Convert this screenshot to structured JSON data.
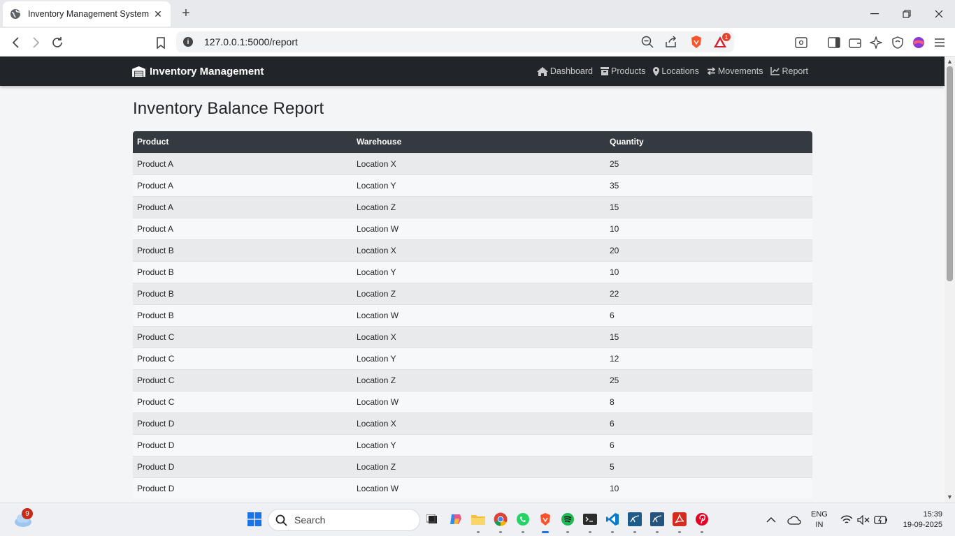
{
  "browser": {
    "tab_title": "Inventory Management System",
    "url": "127.0.0.1:5000/report",
    "shields_badge": "1"
  },
  "navbar": {
    "brand": "Inventory Management",
    "links": [
      "Dashboard",
      "Products",
      "Locations",
      "Movements",
      "Report"
    ]
  },
  "page": {
    "title": "Inventory Balance Report",
    "columns": [
      "Product",
      "Warehouse",
      "Quantity"
    ],
    "rows": [
      [
        "Product A",
        "Location X",
        "25"
      ],
      [
        "Product A",
        "Location Y",
        "35"
      ],
      [
        "Product A",
        "Location Z",
        "15"
      ],
      [
        "Product A",
        "Location W",
        "10"
      ],
      [
        "Product B",
        "Location X",
        "20"
      ],
      [
        "Product B",
        "Location Y",
        "10"
      ],
      [
        "Product B",
        "Location Z",
        "22"
      ],
      [
        "Product B",
        "Location W",
        "6"
      ],
      [
        "Product C",
        "Location X",
        "15"
      ],
      [
        "Product C",
        "Location Y",
        "12"
      ],
      [
        "Product C",
        "Location Z",
        "25"
      ],
      [
        "Product C",
        "Location W",
        "8"
      ],
      [
        "Product D",
        "Location X",
        "6"
      ],
      [
        "Product D",
        "Location Y",
        "6"
      ],
      [
        "Product D",
        "Location Z",
        "5"
      ],
      [
        "Product D",
        "Location W",
        "10"
      ]
    ]
  },
  "taskbar": {
    "weather_badge": "9",
    "search_placeholder": "Search",
    "lang_line1": "ENG",
    "lang_line2": "IN",
    "time": "15:39",
    "date": "19-09-2025"
  },
  "colors": {
    "navbar_bg": "#212529",
    "table_header_bg": "#343a40",
    "row_odd": "#e9eaec",
    "row_even": "#f7f8f9",
    "page_bg": "#f4f5f7"
  },
  "icons": {
    "nav": [
      "home-icon",
      "box-icon",
      "map-marker-icon",
      "exchange-icon",
      "chart-line-icon"
    ],
    "brand": "warehouse-icon"
  }
}
